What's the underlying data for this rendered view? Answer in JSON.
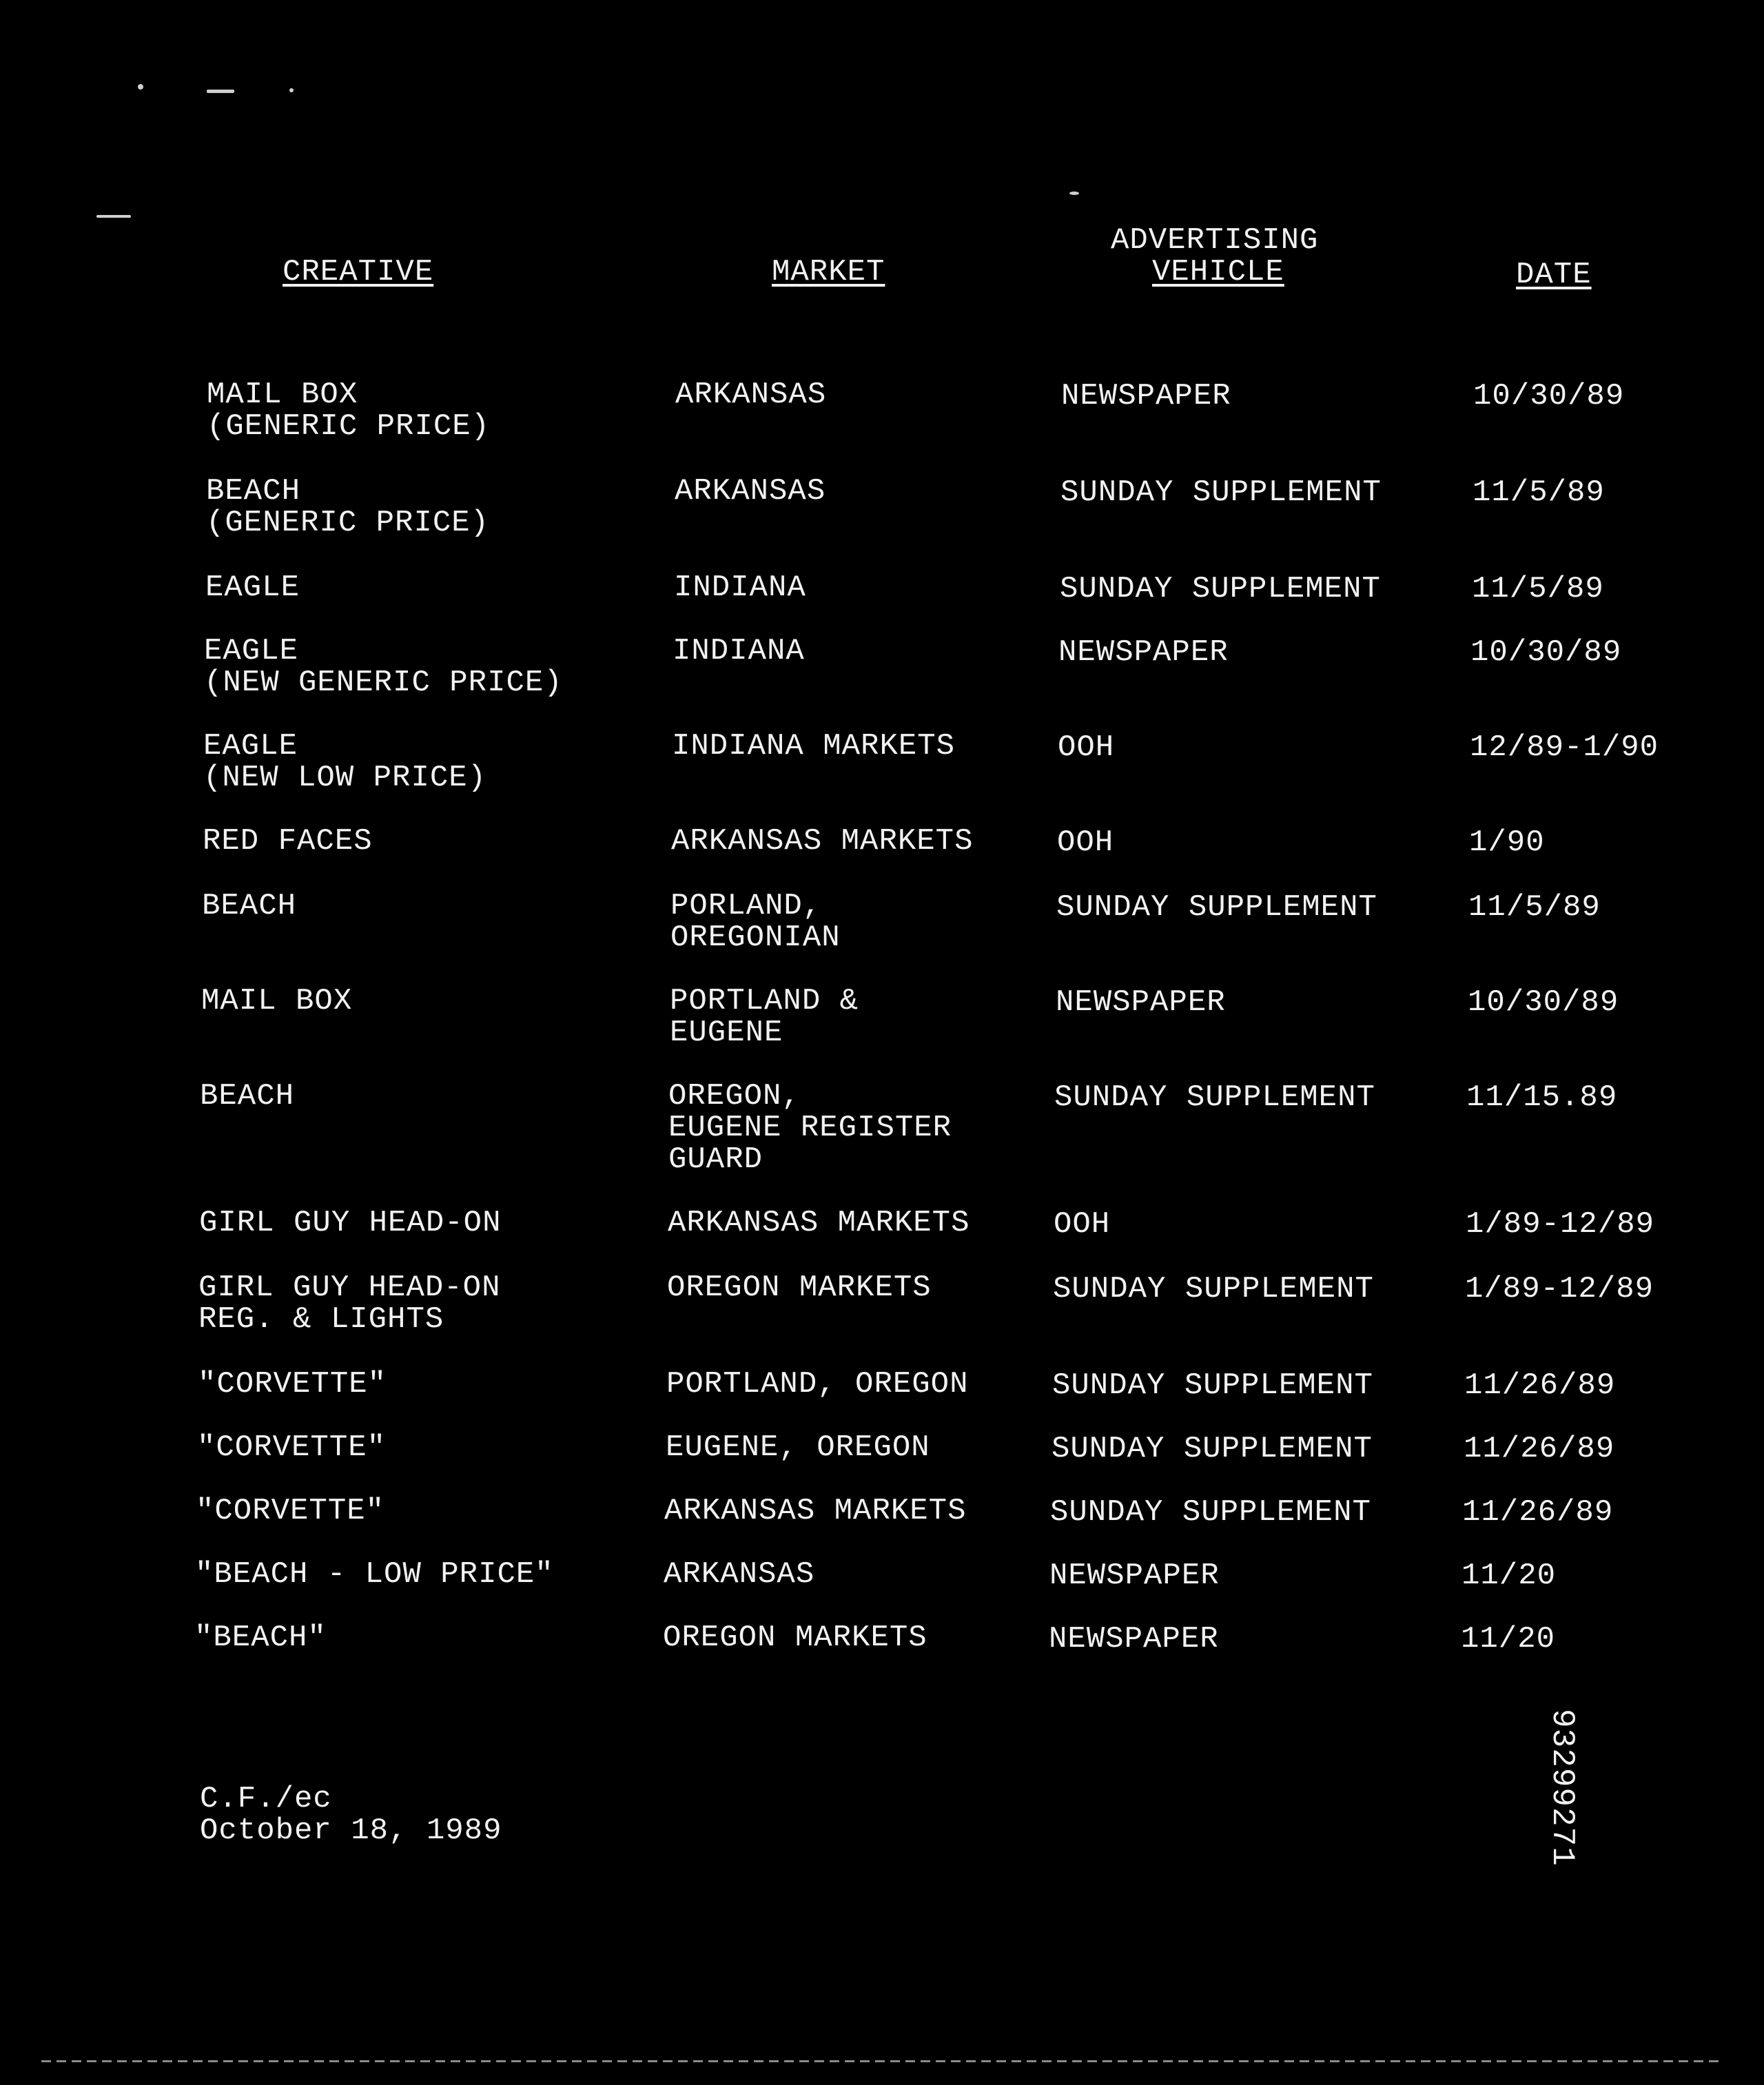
{
  "headers": {
    "creative": "CREATIVE",
    "market": "MARKET",
    "vehicle_top": "ADVERTISING",
    "vehicle_bottom": "VEHICLE",
    "date": "DATE"
  },
  "rows": [
    {
      "creative": [
        "MAIL BOX",
        "(GENERIC PRICE)"
      ],
      "market": [
        "ARKANSAS"
      ],
      "vehicle": "NEWSPAPER",
      "date": "10/30/89"
    },
    {
      "creative": [
        "BEACH",
        "(GENERIC PRICE)"
      ],
      "market": [
        "ARKANSAS"
      ],
      "vehicle": "SUNDAY SUPPLEMENT",
      "date": "11/5/89"
    },
    {
      "creative": [
        "EAGLE"
      ],
      "market": [
        "INDIANA"
      ],
      "vehicle": "SUNDAY SUPPLEMENT",
      "date": "11/5/89"
    },
    {
      "creative": [
        "EAGLE",
        "(NEW GENERIC PRICE)"
      ],
      "market": [
        "INDIANA"
      ],
      "vehicle": "NEWSPAPER",
      "date": "10/30/89"
    },
    {
      "creative": [
        "EAGLE",
        "(NEW LOW PRICE)"
      ],
      "market": [
        "INDIANA MARKETS"
      ],
      "vehicle": "OOH",
      "date": "12/89-1/90"
    },
    {
      "creative": [
        "RED FACES"
      ],
      "market": [
        "ARKANSAS MARKETS"
      ],
      "vehicle": "OOH",
      "date": "1/90"
    },
    {
      "creative": [
        "BEACH"
      ],
      "market": [
        "PORLAND,",
        "OREGONIAN"
      ],
      "vehicle": "SUNDAY SUPPLEMENT",
      "date": "11/5/89"
    },
    {
      "creative": [
        "MAIL BOX"
      ],
      "market": [
        "PORTLAND &",
        "EUGENE"
      ],
      "vehicle": "NEWSPAPER",
      "date": "10/30/89"
    },
    {
      "creative": [
        "BEACH"
      ],
      "market": [
        "OREGON,",
        "EUGENE REGISTER",
        "GUARD"
      ],
      "vehicle": "SUNDAY SUPPLEMENT",
      "date": "11/15.89"
    },
    {
      "creative": [
        "GIRL GUY HEAD-ON"
      ],
      "market": [
        "ARKANSAS MARKETS"
      ],
      "vehicle": "OOH",
      "date": "1/89-12/89"
    },
    {
      "creative": [
        "GIRL GUY HEAD-ON",
        "REG. & LIGHTS"
      ],
      "market": [
        "OREGON MARKETS"
      ],
      "vehicle": "SUNDAY SUPPLEMENT",
      "date": "1/89-12/89"
    },
    {
      "creative": [
        "\"CORVETTE\""
      ],
      "market": [
        "PORTLAND, OREGON"
      ],
      "vehicle": "SUNDAY SUPPLEMENT",
      "date": "11/26/89"
    },
    {
      "creative": [
        "\"CORVETTE\""
      ],
      "market": [
        "EUGENE, OREGON"
      ],
      "vehicle": "SUNDAY SUPPLEMENT",
      "date": "11/26/89"
    },
    {
      "creative": [
        "\"CORVETTE\""
      ],
      "market": [
        "ARKANSAS MARKETS"
      ],
      "vehicle": "SUNDAY SUPPLEMENT",
      "date": "11/26/89"
    },
    {
      "creative": [
        "\"BEACH - LOW PRICE\""
      ],
      "market": [
        "ARKANSAS"
      ],
      "vehicle": "NEWSPAPER",
      "date": "11/20"
    },
    {
      "creative": [
        "\"BEACH\""
      ],
      "market": [
        "OREGON MARKETS"
      ],
      "vehicle": "NEWSPAPER",
      "date": "11/20"
    }
  ],
  "footer": {
    "initials": "C.F./ec",
    "date": "October 18, 1989"
  },
  "document_id": "93299271"
}
